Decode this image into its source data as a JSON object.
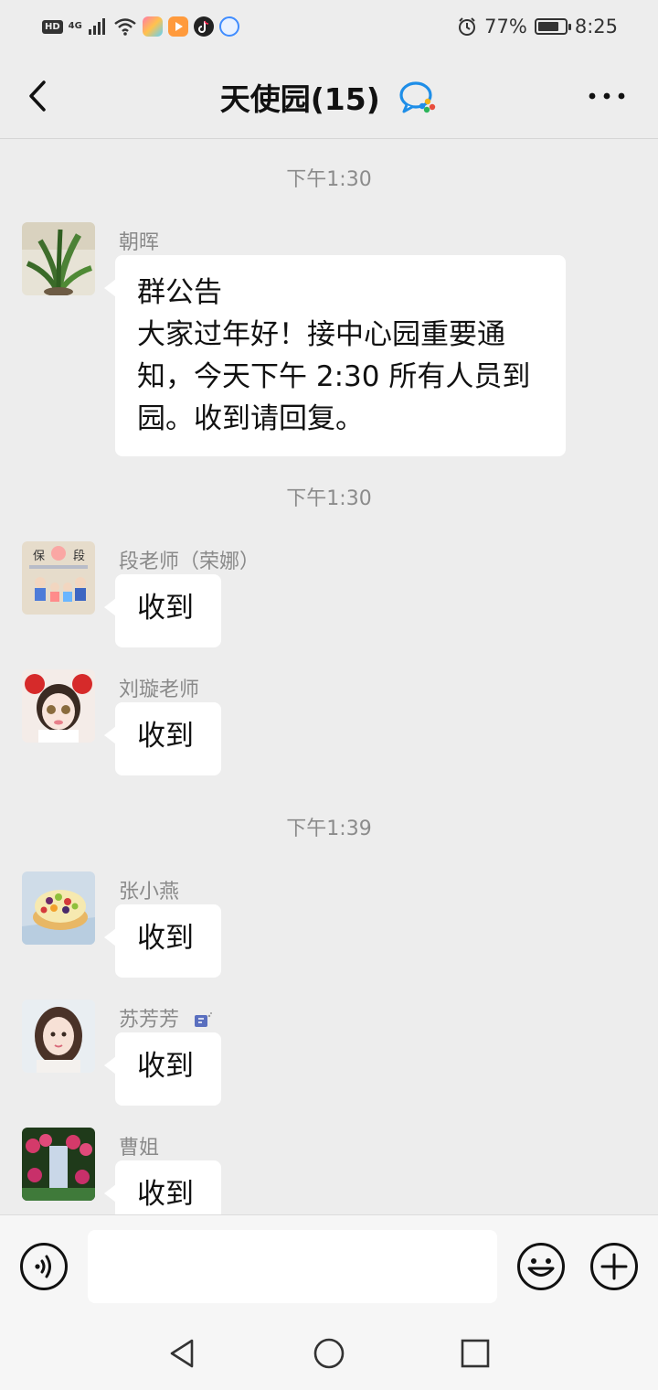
{
  "status_bar": {
    "hd": "HD",
    "network": "4G",
    "battery_percent": "77%",
    "battery_level": 0.77,
    "time": "8:25",
    "app_icons": [
      "gallery-app-icon",
      "video-app-icon",
      "tiktok-app-icon",
      "alipay-app-icon"
    ]
  },
  "header": {
    "title": "天使园(15)",
    "accent_color": "#1aad19"
  },
  "messages": [
    {
      "type": "time",
      "text": "下午1:30"
    },
    {
      "type": "message",
      "sender": "朝晖",
      "text": "群公告\n大家过年好！接中心园重要通知，今天下午 2:30 所有人员到园。收到请回复。",
      "avatar": "plant-avatar"
    },
    {
      "type": "time",
      "text": "下午1:30"
    },
    {
      "type": "message",
      "sender": "段老师（荣娜）",
      "text": "收到",
      "avatar": "cartoon-kids-avatar"
    },
    {
      "type": "message",
      "sender": "刘璇老师",
      "text": "收到",
      "avatar": "girl-red-bows-avatar"
    },
    {
      "type": "time",
      "text": "下午1:39"
    },
    {
      "type": "message",
      "sender": "张小燕",
      "text": "收到",
      "avatar": "fruit-cake-avatar"
    },
    {
      "type": "message",
      "sender": "苏芳芳",
      "text": "收到",
      "avatar": "girl-portrait-avatar"
    },
    {
      "type": "message",
      "sender": "曹姐",
      "text": "收到",
      "avatar": "flowers-waterfall-avatar"
    }
  ],
  "input_bar": {
    "text_value": "",
    "voice_icon": "voice-icon",
    "emoji_icon": "emoji-icon",
    "plus_icon": "plus-icon"
  },
  "nav_bar": {
    "icons": [
      "nav-back-icon",
      "nav-home-icon",
      "nav-recent-icon"
    ]
  }
}
